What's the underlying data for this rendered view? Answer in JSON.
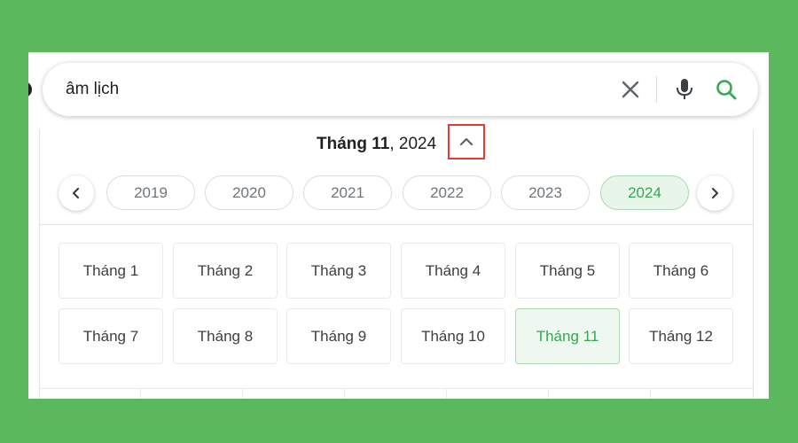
{
  "search": {
    "query": "âm lịch",
    "clear_icon": "close-icon",
    "mic_icon": "mic-icon",
    "search_icon": "search-icon"
  },
  "calendar": {
    "heading_month": "Tháng 11",
    "heading_sep": ", ",
    "heading_year": "2024",
    "collapse_icon": "chevron-up-icon",
    "prev_icon": "chevron-left-icon",
    "next_icon": "chevron-right-icon",
    "years": [
      "2019",
      "2020",
      "2021",
      "2022",
      "2023",
      "2024"
    ],
    "selected_year": "2024",
    "months": [
      "Tháng 1",
      "Tháng 2",
      "Tháng 3",
      "Tháng 4",
      "Tháng 5",
      "Tháng 6",
      "Tháng 7",
      "Tháng 8",
      "Tháng 9",
      "Tháng 10",
      "Tháng 11",
      "Tháng 12"
    ],
    "selected_month": "Tháng 11"
  },
  "colors": {
    "background": "#5cb85c",
    "accent": "#34a853",
    "highlight_box": "#e53935"
  }
}
